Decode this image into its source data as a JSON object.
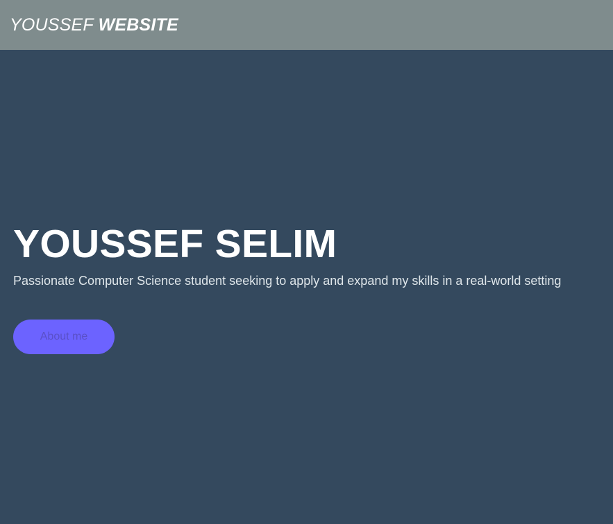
{
  "header": {
    "brand_light": "YOUSSEF",
    "brand_bold": "WEBSITE"
  },
  "hero": {
    "title": "YOUSSEF SELIM",
    "subtitle": "Passionate Computer Science student seeking to apply and expand my skills in a real-world setting",
    "cta_label": "About me"
  },
  "colors": {
    "header_bg": "#7f8c8d",
    "page_bg": "#34495e",
    "button_bg": "#6c63ff",
    "button_text": "#5a50c8"
  }
}
